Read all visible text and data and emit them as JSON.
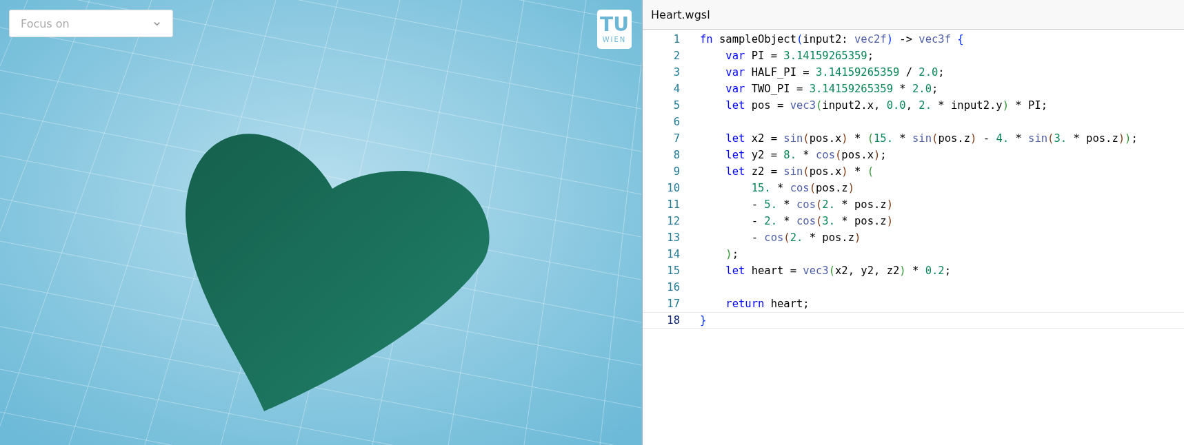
{
  "viewport": {
    "focus_dropdown": {
      "placeholder": "Focus on",
      "chevron": "⌄"
    },
    "logo": {
      "top": "TU",
      "bottom": "WIEN"
    }
  },
  "editor": {
    "tab": {
      "label": "Heart.wgsl",
      "selected": true
    },
    "lines": [
      {
        "number": "1",
        "current": false,
        "tokens": [
          {
            "text": "fn",
            "kind": "kw"
          },
          {
            "text": " sampleObject",
            "kind": "plain"
          },
          {
            "text": "(",
            "kind": "p1"
          },
          {
            "text": "input2: ",
            "kind": "plain"
          },
          {
            "text": "vec2f",
            "kind": "type"
          },
          {
            "text": ")",
            "kind": "p1"
          },
          {
            "text": " -> ",
            "kind": "plain"
          },
          {
            "text": "vec3f",
            "kind": "type"
          },
          {
            "text": " {",
            "kind": "p1"
          }
        ]
      },
      {
        "number": "2",
        "current": false,
        "tokens": [
          {
            "text": "    var",
            "kind": "kw"
          },
          {
            "text": " PI = ",
            "kind": "plain"
          },
          {
            "text": "3.14159265359",
            "kind": "num"
          },
          {
            "text": ";",
            "kind": "plain"
          }
        ]
      },
      {
        "number": "3",
        "current": false,
        "tokens": [
          {
            "text": "    var",
            "kind": "kw"
          },
          {
            "text": " HALF_PI = ",
            "kind": "plain"
          },
          {
            "text": "3.14159265359",
            "kind": "num"
          },
          {
            "text": " / ",
            "kind": "plain"
          },
          {
            "text": "2.0",
            "kind": "num"
          },
          {
            "text": ";",
            "kind": "plain"
          }
        ]
      },
      {
        "number": "4",
        "current": false,
        "tokens": [
          {
            "text": "    var",
            "kind": "kw"
          },
          {
            "text": " TWO_PI = ",
            "kind": "plain"
          },
          {
            "text": "3.14159265359",
            "kind": "num"
          },
          {
            "text": " * ",
            "kind": "plain"
          },
          {
            "text": "2.0",
            "kind": "num"
          },
          {
            "text": ";",
            "kind": "plain"
          }
        ]
      },
      {
        "number": "5",
        "current": false,
        "tokens": [
          {
            "text": "    let",
            "kind": "kw"
          },
          {
            "text": " pos = ",
            "kind": "plain"
          },
          {
            "text": "vec3",
            "kind": "type"
          },
          {
            "text": "(",
            "kind": "p2"
          },
          {
            "text": "input2.x, ",
            "kind": "plain"
          },
          {
            "text": "0.0",
            "kind": "num"
          },
          {
            "text": ", ",
            "kind": "plain"
          },
          {
            "text": "2.",
            "kind": "num"
          },
          {
            "text": " * input2.y",
            "kind": "plain"
          },
          {
            "text": ")",
            "kind": "p2"
          },
          {
            "text": " * PI;",
            "kind": "plain"
          }
        ]
      },
      {
        "number": "6",
        "current": false
      },
      {
        "number": "7",
        "current": false,
        "tokens": [
          {
            "text": "    let",
            "kind": "kw"
          },
          {
            "text": " x2 = ",
            "kind": "plain"
          },
          {
            "text": "sin",
            "kind": "type"
          },
          {
            "text": "(",
            "kind": "p3"
          },
          {
            "text": "pos.x",
            "kind": "plain"
          },
          {
            "text": ")",
            "kind": "p3"
          },
          {
            "text": " * ",
            "kind": "plain"
          },
          {
            "text": "(",
            "kind": "p2"
          },
          {
            "text": "15.",
            "kind": "num"
          },
          {
            "text": " * ",
            "kind": "plain"
          },
          {
            "text": "sin",
            "kind": "type"
          },
          {
            "text": "(",
            "kind": "p3"
          },
          {
            "text": "pos.z",
            "kind": "plain"
          },
          {
            "text": ")",
            "kind": "p3"
          },
          {
            "text": " - ",
            "kind": "plain"
          },
          {
            "text": "4.",
            "kind": "num"
          },
          {
            "text": " * ",
            "kind": "plain"
          },
          {
            "text": "sin",
            "kind": "type"
          },
          {
            "text": "(",
            "kind": "p3"
          },
          {
            "text": "3.",
            "kind": "num"
          },
          {
            "text": " * pos.z",
            "kind": "plain"
          },
          {
            "text": ")",
            "kind": "p3"
          },
          {
            "text": ")",
            "kind": "p2"
          },
          {
            "text": ";",
            "kind": "plain"
          }
        ]
      },
      {
        "number": "8",
        "current": false,
        "tokens": [
          {
            "text": "    let",
            "kind": "kw"
          },
          {
            "text": " y2 = ",
            "kind": "plain"
          },
          {
            "text": "8.",
            "kind": "num"
          },
          {
            "text": " * ",
            "kind": "plain"
          },
          {
            "text": "cos",
            "kind": "type"
          },
          {
            "text": "(",
            "kind": "p3"
          },
          {
            "text": "pos.x",
            "kind": "plain"
          },
          {
            "text": ")",
            "kind": "p3"
          },
          {
            "text": ";",
            "kind": "plain"
          }
        ]
      },
      {
        "number": "9",
        "current": false,
        "tokens": [
          {
            "text": "    let",
            "kind": "kw"
          },
          {
            "text": " z2 = ",
            "kind": "plain"
          },
          {
            "text": "sin",
            "kind": "type"
          },
          {
            "text": "(",
            "kind": "p3"
          },
          {
            "text": "pos.x",
            "kind": "plain"
          },
          {
            "text": ")",
            "kind": "p3"
          },
          {
            "text": " * ",
            "kind": "plain"
          },
          {
            "text": "(",
            "kind": "p2"
          }
        ]
      },
      {
        "number": "10",
        "current": false,
        "tokens": [
          {
            "text": "        15.",
            "kind": "num"
          },
          {
            "text": " * ",
            "kind": "plain"
          },
          {
            "text": "cos",
            "kind": "type"
          },
          {
            "text": "(",
            "kind": "p3"
          },
          {
            "text": "pos.z",
            "kind": "plain"
          },
          {
            "text": ")",
            "kind": "p3"
          }
        ]
      },
      {
        "number": "11",
        "current": false,
        "tokens": [
          {
            "text": "        - ",
            "kind": "plain"
          },
          {
            "text": "5.",
            "kind": "num"
          },
          {
            "text": " * ",
            "kind": "plain"
          },
          {
            "text": "cos",
            "kind": "type"
          },
          {
            "text": "(",
            "kind": "p3"
          },
          {
            "text": "2.",
            "kind": "num"
          },
          {
            "text": " * pos.z",
            "kind": "plain"
          },
          {
            "text": ")",
            "kind": "p3"
          }
        ]
      },
      {
        "number": "12",
        "current": false,
        "tokens": [
          {
            "text": "        - ",
            "kind": "plain"
          },
          {
            "text": "2.",
            "kind": "num"
          },
          {
            "text": " * ",
            "kind": "plain"
          },
          {
            "text": "cos",
            "kind": "type"
          },
          {
            "text": "(",
            "kind": "p3"
          },
          {
            "text": "3.",
            "kind": "num"
          },
          {
            "text": " * pos.z",
            "kind": "plain"
          },
          {
            "text": ")",
            "kind": "p3"
          }
        ]
      },
      {
        "number": "13",
        "current": false,
        "tokens": [
          {
            "text": "        - ",
            "kind": "plain"
          },
          {
            "text": "cos",
            "kind": "type"
          },
          {
            "text": "(",
            "kind": "p3"
          },
          {
            "text": "2.",
            "kind": "num"
          },
          {
            "text": " * pos.z",
            "kind": "plain"
          },
          {
            "text": ")",
            "kind": "p3"
          }
        ]
      },
      {
        "number": "14",
        "current": false,
        "tokens": [
          {
            "text": "    )",
            "kind": "p2"
          },
          {
            "text": ";",
            "kind": "plain"
          }
        ]
      },
      {
        "number": "15",
        "current": false,
        "tokens": [
          {
            "text": "    let",
            "kind": "kw"
          },
          {
            "text": " heart = ",
            "kind": "plain"
          },
          {
            "text": "vec3",
            "kind": "type"
          },
          {
            "text": "(",
            "kind": "p2"
          },
          {
            "text": "x2, y2, z2",
            "kind": "plain"
          },
          {
            "text": ")",
            "kind": "p2"
          },
          {
            "text": " * ",
            "kind": "plain"
          },
          {
            "text": "0.2",
            "kind": "num"
          },
          {
            "text": ";",
            "kind": "plain"
          }
        ]
      },
      {
        "number": "16",
        "current": false
      },
      {
        "number": "17",
        "current": false,
        "tokens": [
          {
            "text": "    return",
            "kind": "kw"
          },
          {
            "text": " heart;",
            "kind": "plain"
          }
        ]
      },
      {
        "number": "18",
        "current": true,
        "tokens": [
          {
            "text": "}",
            "kind": "p1"
          }
        ]
      }
    ]
  }
}
